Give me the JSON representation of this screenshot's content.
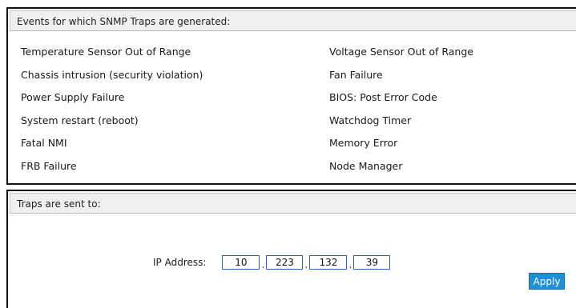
{
  "events": {
    "title": "Events for which SNMP Traps are generated:",
    "rows": [
      {
        "left": "Temperature Sensor Out of Range",
        "right": "Voltage Sensor Out of Range"
      },
      {
        "left": "Chassis intrusion (security violation)",
        "right": "Fan Failure"
      },
      {
        "left": "Power Supply Failure",
        "right": "BIOS: Post Error Code"
      },
      {
        "left": "System restart (reboot)",
        "right": "Watchdog Timer"
      },
      {
        "left": "Fatal NMI",
        "right": "Memory Error"
      },
      {
        "left": "FRB Failure",
        "right": "Node Manager"
      }
    ]
  },
  "traps": {
    "title": "Traps are sent to:",
    "ip_label": "IP Address:",
    "ip_octets": [
      "10",
      "223",
      "132",
      "39"
    ],
    "separator": ".",
    "apply_label": "Apply"
  }
}
